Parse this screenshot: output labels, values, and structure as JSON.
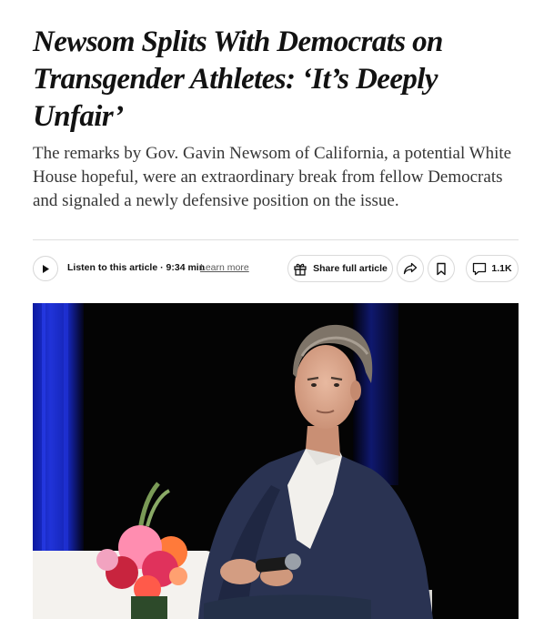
{
  "article": {
    "headline": "Newsom Splits With Democrats on Transgender Athletes: ‘It’s Deeply Unfair’",
    "summary": "The remarks by Gov. Gavin Newsom of California, a potential White House hopeful, were an extraordinary break from fellow Democrats and signaled a newly defensive position on the issue."
  },
  "toolbar": {
    "listen_label": "Listen to this article · 9:34 min",
    "learn_more": "Learn more",
    "share_full_label": "Share full article",
    "comments_count": "1.1K"
  },
  "icons": {
    "play": "play-icon",
    "gift": "gift-icon",
    "share": "share-arrow-icon",
    "bookmark": "bookmark-icon",
    "comment": "comment-bubble-icon"
  },
  "colors": {
    "text": "#121212",
    "summary_text": "#363636",
    "curtain_blue": "#1e2fd0",
    "suit_navy": "#2a3352"
  }
}
